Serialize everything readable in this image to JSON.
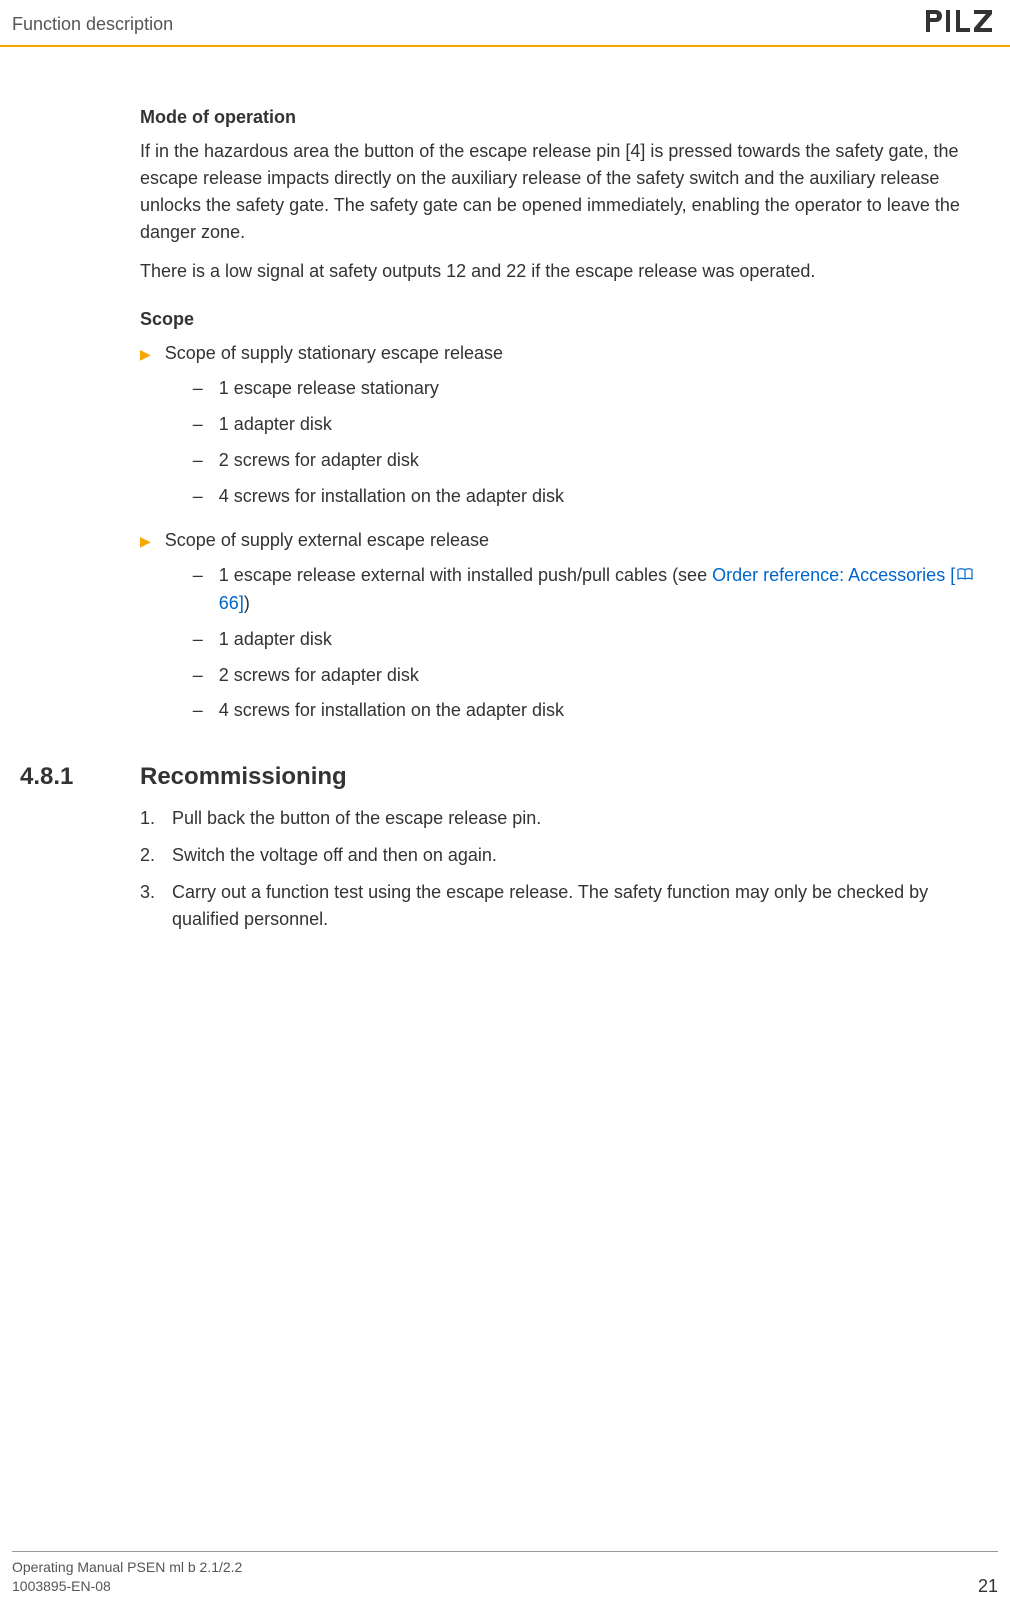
{
  "header": {
    "title": "Function description",
    "logo": "PILZ"
  },
  "mode": {
    "heading": "Mode of operation",
    "p1": "If in the hazardous area the button of the escape release pin [4] is pressed towards the safety gate, the escape release impacts directly on the auxiliary release of the safety switch and the auxiliary release unlocks the safety gate. The safety gate can be opened immediately, enabling the operator to leave the danger zone.",
    "p2": "There is a low signal at safety outputs 12 and 22 if the escape release was operated."
  },
  "scope": {
    "heading": "Scope",
    "group1": {
      "label": "Scope of supply stationary escape release",
      "items": [
        "1 escape release stationary",
        "1 adapter disk",
        "2 screws for adapter disk",
        "4 screws for installation on the adapter disk"
      ]
    },
    "group2": {
      "label": "Scope of supply external escape release",
      "item0_prefix": "1 escape release external with installed push/pull cables (see ",
      "item0_link1": "Order reference: Accessories [",
      "item0_link2": " 66]",
      "item0_suffix": ")",
      "items_rest": [
        "1 adapter disk",
        "2 screws for adapter disk",
        "4 screws for installation on the adapter disk"
      ]
    }
  },
  "section": {
    "number": "4.8.1",
    "title": "Recommissioning",
    "steps": [
      "Pull back the button of the escape release pin.",
      "Switch the voltage off and then on again.",
      "Carry out a function test using the escape release. The safety function may only be checked by qualified personnel."
    ],
    "step_nums": [
      "1.",
      "2.",
      "3."
    ]
  },
  "footer": {
    "line1": "Operating Manual PSEN ml b 2.1/2.2",
    "line2": "1003895-EN-08",
    "page": "21"
  }
}
